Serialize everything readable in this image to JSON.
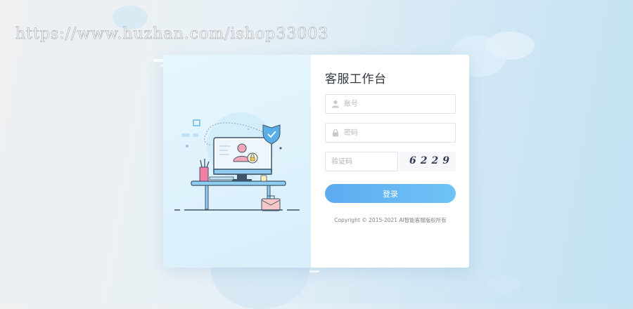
{
  "watermark": "https://www.huzhan.com/ishop33003",
  "login": {
    "title": "客服工作台",
    "account_placeholder": "账号",
    "password_placeholder": "密码",
    "captcha_placeholder": "验证码",
    "captcha_code": "6229",
    "submit_label": "登录",
    "copyright": "Copyright © 2015-2021 AI智能客服版权所有"
  },
  "icons": {
    "account": "user-icon",
    "password": "lock-icon",
    "illustration": "desk-computer-shield-illustration"
  },
  "colors": {
    "accent_start": "#5eaaf0",
    "accent_end": "#6ec4f6",
    "background": "#e6f0f6"
  }
}
